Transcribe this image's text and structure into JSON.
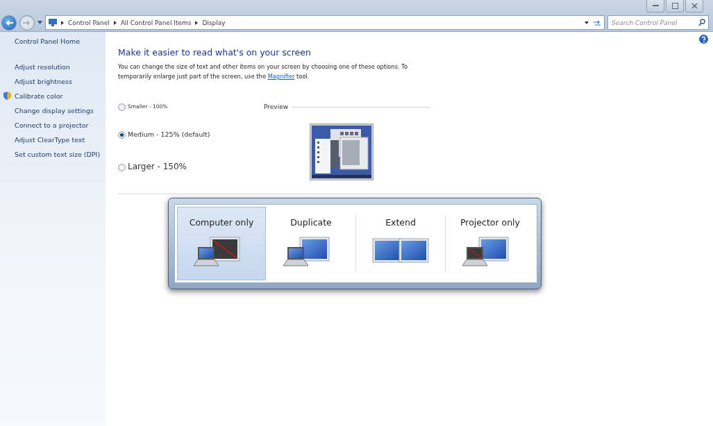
{
  "address_bar": {
    "breadcrumbs": [
      "Control Panel",
      "All Control Panel Items",
      "Display"
    ]
  },
  "search": {
    "placeholder": "Search Control Panel"
  },
  "sidebar": {
    "home": "Control Panel Home",
    "items": [
      {
        "label": "Adjust resolution",
        "shield": false
      },
      {
        "label": "Adjust brightness",
        "shield": false
      },
      {
        "label": "Calibrate color",
        "shield": true
      },
      {
        "label": "Change display settings",
        "shield": false
      },
      {
        "label": "Connect to a projector",
        "shield": false
      },
      {
        "label": "Adjust ClearType text",
        "shield": false
      },
      {
        "label": "Set custom text size (DPI)",
        "shield": false
      }
    ]
  },
  "main": {
    "heading": "Make it easier to read what's on your screen",
    "description": {
      "before": "You can change the size of text and other items on your screen by choosing one of these options. To temporarily enlarge just part of the screen, use the ",
      "link": "Magnifier",
      "after": " tool."
    },
    "size_options": [
      {
        "label": "Smaller - 100%",
        "kind": "small",
        "selected": false
      },
      {
        "label": "Medium - 125% (default)",
        "kind": "medium",
        "selected": true
      },
      {
        "label": "Larger - 150%",
        "kind": "large",
        "selected": false
      }
    ],
    "preview_label": "Preview"
  },
  "projector_switcher": {
    "options": [
      {
        "label": "Computer only",
        "kind": "computer",
        "selected": true
      },
      {
        "label": "Duplicate",
        "kind": "duplicate",
        "selected": false
      },
      {
        "label": "Extend",
        "kind": "extend",
        "selected": false
      },
      {
        "label": "Projector only",
        "kind": "projector",
        "selected": false
      }
    ]
  }
}
